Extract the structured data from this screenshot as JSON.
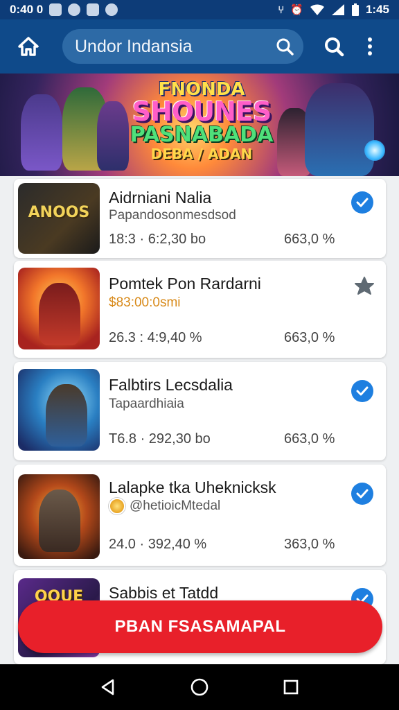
{
  "status_bar": {
    "time": "0:40 0",
    "right_time": "1:45"
  },
  "app_bar": {
    "search_text": "Undor Indansia"
  },
  "banner": {
    "title_line1": "FNONDA",
    "title_line2": "SHOUNES",
    "title_line3": "PASNABADA",
    "title_line4": "DEBA / ADAN"
  },
  "items": [
    {
      "title": "Aidrniani Nalia",
      "subtitle": "Papandosonmesdsod",
      "stat_left": "18:3 · 6:2,30 bo",
      "stat_right": "663,0 %",
      "badge": "verified",
      "thumb_label": "ANOOS"
    },
    {
      "title": "Pomtek Pon Rardarni",
      "subtitle": "$83:00:0smi",
      "stat_left": "26.3 : 4:9,40 %",
      "stat_right": "663,0 %",
      "badge": "star",
      "thumb_label": ""
    },
    {
      "title": "Falbtirs Lecsdalia",
      "subtitle": "Tapaardhiaia",
      "stat_left": "T6.8 · 292,30 bo",
      "stat_right": "663,0 %",
      "badge": "verified",
      "thumb_label": ""
    },
    {
      "title": "Lalapke tka Uheknicksk",
      "subtitle": "@hetioicMtedal",
      "stat_left": "24.0 · 392,40 %",
      "stat_right": "363,0 %",
      "badge": "verified",
      "thumb_label": ""
    },
    {
      "title": "Sabbis et Tatdd",
      "subtitle": "",
      "stat_left": "",
      "stat_right": "",
      "badge": "verified",
      "thumb_label": "OOUE"
    }
  ],
  "cta": {
    "label": "PBAN FSASAMAPAL"
  },
  "colors": {
    "app_bar": "#0f4a8a",
    "status_bar": "#0d3c78",
    "accent_blue": "#1e7fe0",
    "cta_red": "#e8202a"
  }
}
